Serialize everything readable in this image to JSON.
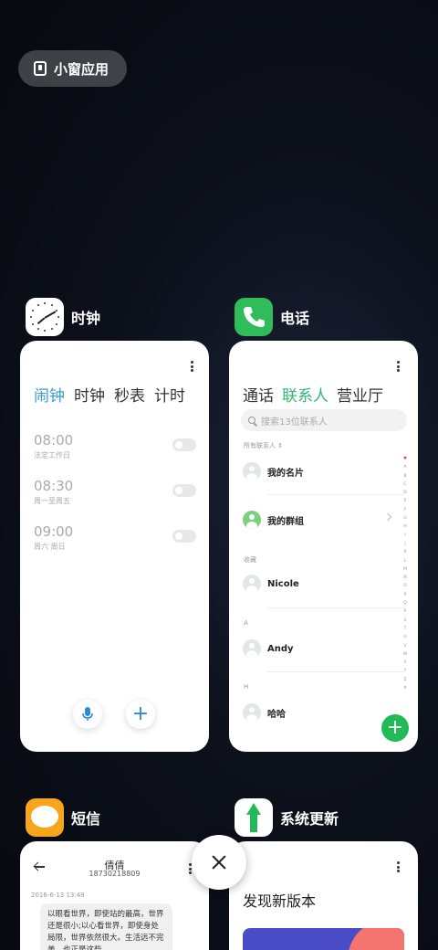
{
  "floating_window": {
    "label": "小窗应用"
  },
  "apps": {
    "clock": {
      "name": "时钟",
      "tabs": [
        "闹钟",
        "时钟",
        "秒表",
        "计时"
      ],
      "alarms": [
        {
          "time": "08:00",
          "repeat": "法定工作日"
        },
        {
          "time": "08:30",
          "repeat": "周一至周五"
        },
        {
          "time": "09:00",
          "repeat": "周六 周日"
        }
      ]
    },
    "phone": {
      "name": "电话",
      "tabs": [
        "通话",
        "联系人",
        "营业厅"
      ],
      "search_placeholder": "搜索13位联系人",
      "all_contacts_label": "所有联系人",
      "my_card": "我的名片",
      "my_groups": "我的群组",
      "favorites_label": "收藏",
      "sections": [
        {
          "header": "",
          "contact": "Nicole"
        },
        {
          "header": "A",
          "contact": "Andy"
        },
        {
          "header": "H",
          "contact": "哈哈"
        }
      ],
      "index_letters": [
        "♥",
        "A",
        "B",
        "C",
        "D",
        "E",
        "F",
        "G",
        "H",
        "I",
        "J",
        "K",
        "L",
        "M",
        "N",
        "O",
        "P",
        "Q",
        "R",
        "S",
        "T",
        "U",
        "V",
        "W",
        "X",
        "Y",
        "Z",
        "#"
      ]
    },
    "messages": {
      "name": "短信",
      "contact_name": "倩倩",
      "contact_number": "18730218809",
      "timestamp": "2016-6-13 13:49",
      "message_text": "以眼看世界，即使站的最高，世界还是很小;以心看世界，即使身处局限，世界依然很大。生活远不完美，也正是这些..."
    },
    "update": {
      "name": "系统更新",
      "title": "发现新版本"
    }
  },
  "colors": {
    "clock_accent": "#3a9ad9",
    "phone_accent": "#2eb872",
    "fab_green": "#22b957",
    "messages_orange": "#f7a51c"
  }
}
